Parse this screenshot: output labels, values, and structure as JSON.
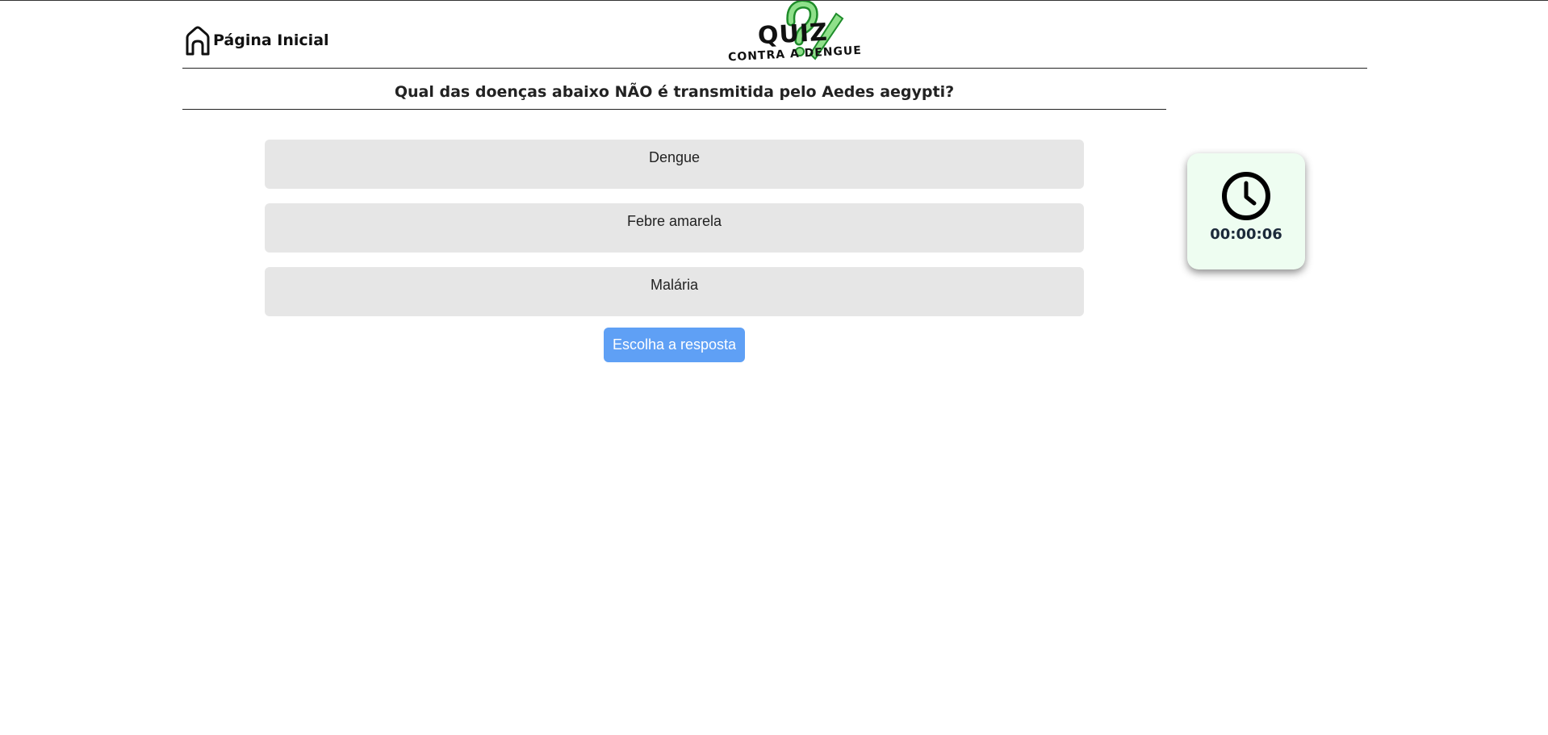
{
  "header": {
    "home_label": "Página Inicial",
    "logo": {
      "word": "QUIZ",
      "subtitle": "CONTRA A DENGUE",
      "accent_color": "#3bbf3b"
    }
  },
  "quiz": {
    "question": "Qual das doenças abaixo NÃO é transmitida pelo Aedes aegypti?",
    "options": [
      "Dengue",
      "Febre amarela",
      "Malária"
    ],
    "submit_label": "Escolha a resposta"
  },
  "timer": {
    "icon": "clock-icon",
    "value": "00:00:06"
  },
  "colors": {
    "option_bg": "#e6e6e6",
    "submit_bg": "#5fa0f5",
    "timer_bg": "#eefdf1"
  }
}
